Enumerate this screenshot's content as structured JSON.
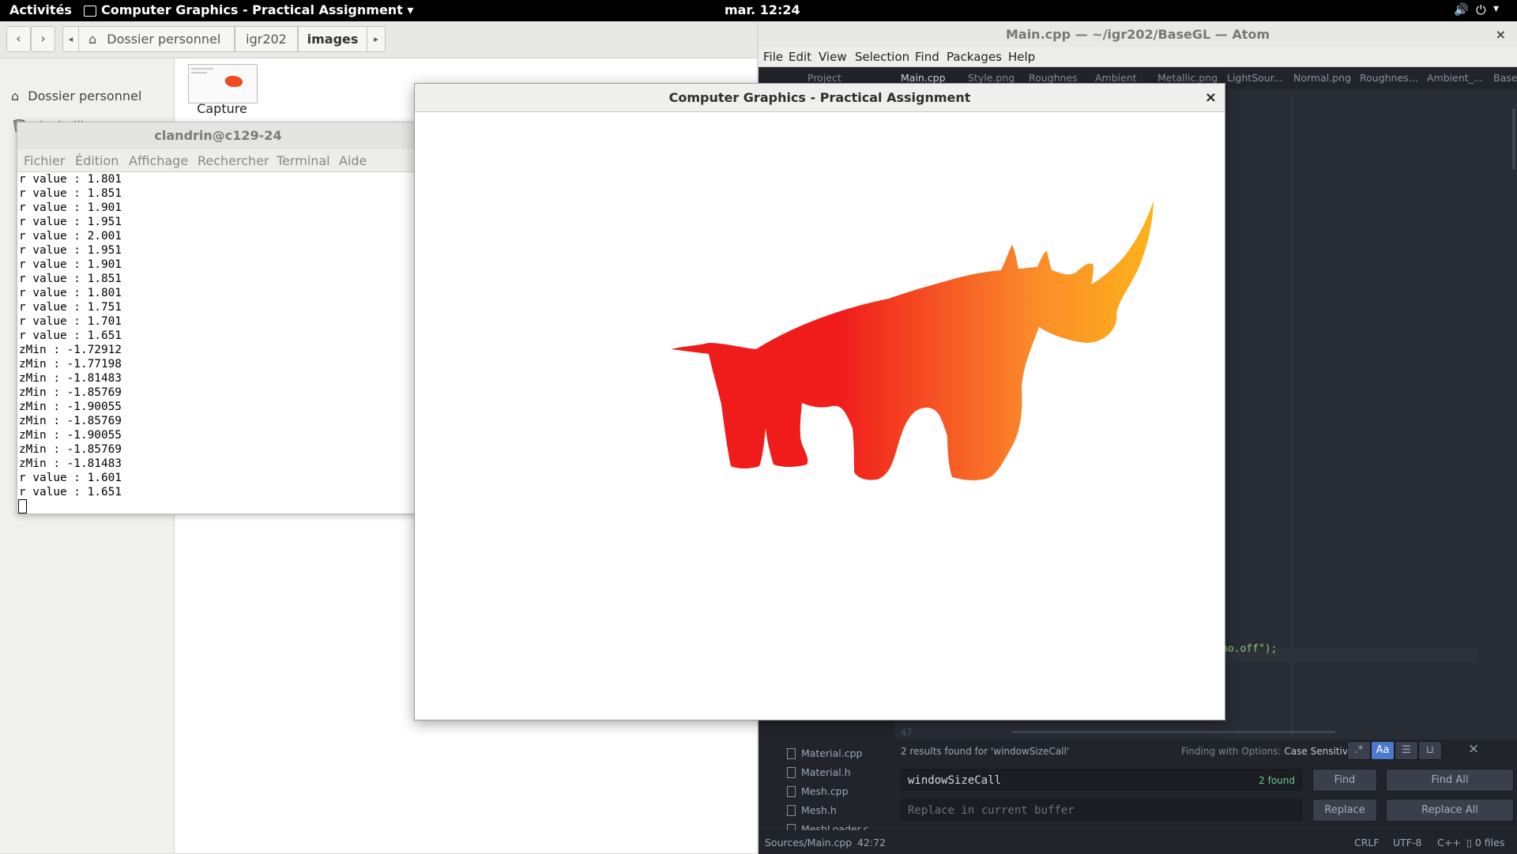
{
  "topbar": {
    "activities": "Activités",
    "app_name": "Computer Graphics - Practical Assignment",
    "clock": "mar. 12:24"
  },
  "nautilus": {
    "breadcrumbs": [
      "Dossier personnel",
      "igr202",
      "images"
    ],
    "sidebar": [
      {
        "icon": "home-icon",
        "label": "Dossier personnel"
      },
      {
        "icon": "trash-icon",
        "label": "Corbeille"
      }
    ],
    "file": {
      "label": "Capture"
    }
  },
  "terminal": {
    "title": "clandrin@c129-24",
    "menu": [
      "Fichier",
      "Édition",
      "Affichage",
      "Rechercher",
      "Terminal",
      "Aide"
    ],
    "lines": [
      "r value : 1.801",
      "r value : 1.851",
      "r value : 1.901",
      "r value : 1.951",
      "r value : 2.001",
      "r value : 1.951",
      "r value : 1.901",
      "r value : 1.851",
      "r value : 1.801",
      "r value : 1.751",
      "r value : 1.701",
      "r value : 1.651",
      "zMin : -1.72912",
      "zMin : -1.77198",
      "zMin : -1.81483",
      "zMin : -1.85769",
      "zMin : -1.90055",
      "zMin : -1.85769",
      "zMin : -1.90055",
      "zMin : -1.85769",
      "zMin : -1.81483",
      "r value : 1.601",
      "r value : 1.651"
    ]
  },
  "atom": {
    "title": "Main.cpp — ~/igr202/BaseGL — Atom",
    "menu": [
      "File",
      "Edit",
      "View",
      "Selection",
      "Find",
      "Packages",
      "Help"
    ],
    "tabs": [
      "Project",
      "Main.cpp",
      "Style.png",
      "Roughnes",
      "Ambient",
      "Metallic.png",
      "LightSour...",
      "Normal.png",
      "Roughnes...",
      "Ambient_...",
      "Base"
    ],
    "code_fragment": "no.off\");",
    "line_number": "47",
    "tree": [
      "Material.cpp",
      "Material.h",
      "Mesh.cpp",
      "Mesh.h",
      "MeshLoader.c"
    ],
    "find": {
      "results_text": "2 results found for 'windowSizeCall'",
      "options_label": "Finding with Options:",
      "options_value": "Case Sensitive",
      "find_value": "windowSizeCall",
      "found_count": "2 found",
      "replace_placeholder": "Replace in current buffer",
      "find_button": "Find",
      "find_all_button": "Find All",
      "replace_button": "Replace",
      "replace_all_button": "Replace All",
      "regex_label": ".*",
      "case_label": "Aa"
    },
    "status": {
      "path": "Sources/Main.cpp",
      "cursor": "42:72",
      "line_ending": "CRLF",
      "encoding": "UTF-8",
      "grammar": "C++",
      "files": "0 files"
    }
  },
  "glwindow": {
    "title": "Computer Graphics - Practical Assignment",
    "close": "×"
  },
  "colors": {
    "rhino_red": "#f01c1c",
    "rhino_orange": "#fb8a2a",
    "rhino_yellow": "#fdb31a"
  }
}
